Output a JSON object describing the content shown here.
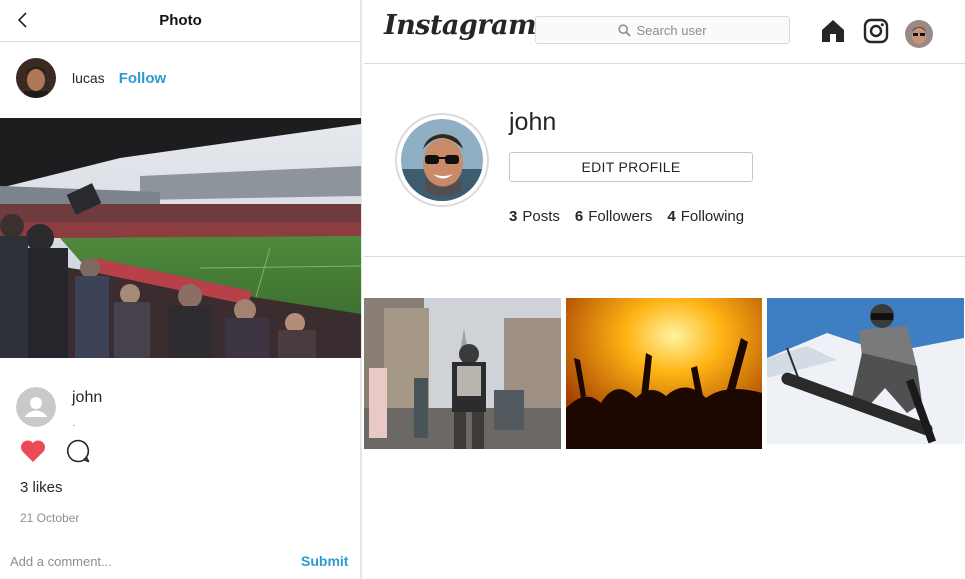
{
  "photo_view": {
    "title": "Photo",
    "owner": {
      "name": "lucas",
      "follow_label": "Follow"
    },
    "comment": {
      "user": "john",
      "text": "."
    },
    "likes_count": "3",
    "likes_label": "likes",
    "date": "21 October",
    "comment_placeholder": "Add a comment...",
    "submit_label": "Submit",
    "icons": [
      "chevron-left-icon",
      "heart-icon",
      "comment-bubble-icon",
      "default-user-icon"
    ]
  },
  "profile": {
    "brand": "Instagram",
    "search_placeholder": "Search user",
    "username": "john",
    "edit_label": "EDIT PROFILE",
    "stats": [
      {
        "value": "3",
        "label": "Posts"
      },
      {
        "value": "6",
        "label": "Followers"
      },
      {
        "value": "4",
        "label": "Following"
      }
    ],
    "icons": [
      "search-icon",
      "home-icon",
      "instagram-camera-icon"
    ],
    "posts": [
      "city-street-post",
      "concert-crowd-post",
      "snowboard-post"
    ]
  },
  "colors": {
    "link_blue": "#2d9ad2",
    "heart_red": "#ed4956",
    "border": "#dbdbdb",
    "text": "#262626"
  }
}
